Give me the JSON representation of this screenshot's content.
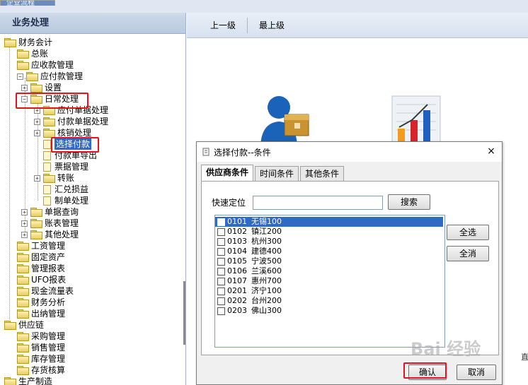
{
  "topbar": {
    "tab": "企业流程"
  },
  "sidebar": {
    "title": "业务处理",
    "tree": [
      {
        "label": "财务会计",
        "level": 0,
        "expander": "",
        "kind": "folder-open"
      },
      {
        "label": "总账",
        "level": 1,
        "expander": "",
        "kind": "folder"
      },
      {
        "label": "应收款管理",
        "level": 1,
        "expander": "",
        "kind": "folder"
      },
      {
        "label": "应付款管理",
        "level": 1,
        "expander": "minus",
        "kind": "folder-open"
      },
      {
        "label": "设置",
        "level": 2,
        "expander": "plus",
        "kind": "folder"
      },
      {
        "label": "日常处理",
        "level": 2,
        "expander": "minus",
        "kind": "folder-open"
      },
      {
        "label": "应付单据处理",
        "level": 3,
        "expander": "plus",
        "kind": "folder"
      },
      {
        "label": "付款单据处理",
        "level": 3,
        "expander": "plus",
        "kind": "folder"
      },
      {
        "label": "核销处理",
        "level": 3,
        "expander": "plus",
        "kind": "folder"
      },
      {
        "label": "选择付款",
        "level": 3,
        "expander": "",
        "kind": "page",
        "selected": true
      },
      {
        "label": "付款单导出",
        "level": 3,
        "expander": "",
        "kind": "page"
      },
      {
        "label": "票据管理",
        "level": 3,
        "expander": "",
        "kind": "page"
      },
      {
        "label": "转账",
        "level": 3,
        "expander": "plus",
        "kind": "folder"
      },
      {
        "label": "汇兑损益",
        "level": 3,
        "expander": "",
        "kind": "page"
      },
      {
        "label": "制单处理",
        "level": 3,
        "expander": "",
        "kind": "page"
      },
      {
        "label": "单据查询",
        "level": 2,
        "expander": "plus",
        "kind": "folder"
      },
      {
        "label": "账表管理",
        "level": 2,
        "expander": "plus",
        "kind": "folder"
      },
      {
        "label": "其他处理",
        "level": 2,
        "expander": "plus",
        "kind": "folder"
      },
      {
        "label": "工资管理",
        "level": 1,
        "expander": "",
        "kind": "folder"
      },
      {
        "label": "固定资产",
        "level": 1,
        "expander": "",
        "kind": "folder"
      },
      {
        "label": "管理报表",
        "level": 1,
        "expander": "",
        "kind": "folder"
      },
      {
        "label": "UFO报表",
        "level": 1,
        "expander": "",
        "kind": "folder"
      },
      {
        "label": "现金流量表",
        "level": 1,
        "expander": "",
        "kind": "folder"
      },
      {
        "label": "财务分析",
        "level": 1,
        "expander": "",
        "kind": "folder"
      },
      {
        "label": "出纳管理",
        "level": 1,
        "expander": "",
        "kind": "folder"
      },
      {
        "label": "供应链",
        "level": 0,
        "expander": "",
        "kind": "folder-open"
      },
      {
        "label": "采购管理",
        "level": 1,
        "expander": "",
        "kind": "folder"
      },
      {
        "label": "销售管理",
        "level": 1,
        "expander": "",
        "kind": "folder"
      },
      {
        "label": "库存管理",
        "level": 1,
        "expander": "",
        "kind": "folder"
      },
      {
        "label": "存货核算",
        "level": 1,
        "expander": "",
        "kind": "folder"
      },
      {
        "label": "生产制造",
        "level": 0,
        "expander": "",
        "kind": "folder-open"
      }
    ]
  },
  "toolbar": {
    "up_label": "上一级",
    "top_label": "最上级"
  },
  "dialog": {
    "title": "选择付款--条件",
    "close": "×",
    "tabs": [
      "供应商条件",
      "时间条件",
      "其他条件"
    ],
    "active_tab": "供应商条件",
    "quick_locate_label": "快速定位",
    "quick_locate_value": "",
    "search_button": "搜索",
    "select_all_button": "全选",
    "deselect_all_button": "全消",
    "ok_button": "确认",
    "cancel_button": "取消",
    "suppliers": [
      {
        "code": "0101",
        "name": "无锡100",
        "selected": true
      },
      {
        "code": "0102",
        "name": "镇江200"
      },
      {
        "code": "0103",
        "name": "杭州300"
      },
      {
        "code": "0104",
        "name": "建德400"
      },
      {
        "code": "0105",
        "name": "宁波500"
      },
      {
        "code": "0106",
        "name": "兰溪600"
      },
      {
        "code": "0107",
        "name": "惠州700"
      },
      {
        "code": "0201",
        "name": "济宁100"
      },
      {
        "code": "0202",
        "name": "台州200"
      },
      {
        "code": "0203",
        "name": "佛山300"
      }
    ]
  },
  "watermark": "Bai 经验",
  "edge_text": "直"
}
